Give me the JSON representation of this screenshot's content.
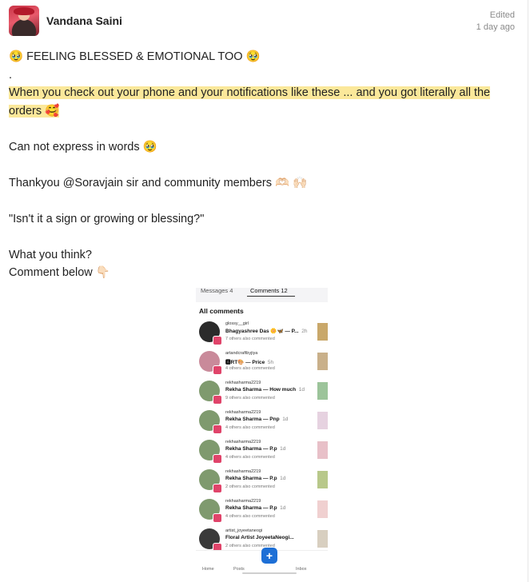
{
  "post": {
    "author": "Vandana Saini",
    "edited": "Edited",
    "time": "1 day ago",
    "lines": {
      "l1": "🥹 FEELING BLESSED & EMOTIONAL TOO 🥹",
      "l2": ".",
      "l3": "When you check out your phone and your notifications like these ... and you got literally all the",
      "l4": "orders 🥰",
      "l5": "Can not express in words 🥹",
      "l6": "Thankyou @Soravjain sir and community members 🫶🏻 🙌🏻",
      "l7": "\"Isn't it a sign or growing or blessing?\"",
      "l8": "What you think?",
      "l9": "Comment below 👇🏻"
    },
    "highlight_color": "#fbe89a"
  },
  "screenshot": {
    "tab_messages": "Messages  4",
    "tab_comments": "Comments  12",
    "all_comments": "All comments",
    "rows": [
      {
        "user": "glossy__girl",
        "msg": "Bhagyashree Das 🌼🦋 — P...",
        "meta": "2h",
        "others": "7 others also commented"
      },
      {
        "user": "artandcraftbyjiya",
        "msg": "🅰RT🎨 — Price",
        "meta": "5h",
        "others": "4 others also commented"
      },
      {
        "user": "rekhasharma2219",
        "msg": "Rekha Sharma — How much",
        "meta": "1d",
        "others": "9 others also commented"
      },
      {
        "user": "rekhasharma2219",
        "msg": "Rekha Sharma — Pnp",
        "meta": "1d",
        "others": "4 others also commented"
      },
      {
        "user": "rekhasharma2219",
        "msg": "Rekha Sharma — P.p",
        "meta": "1d",
        "others": "4 others also commented"
      },
      {
        "user": "rekhasharma2219",
        "msg": "Rekha Sharma — P.p",
        "meta": "1d",
        "others": "2 others also commented"
      },
      {
        "user": "rekhasharma2219",
        "msg": "Rekha Sharma — P.p",
        "meta": "1d",
        "others": "4 others also commented"
      },
      {
        "user": "artist_joyeetaneogi",
        "msg": "Floral Artist JoyeetaNeogi...",
        "meta": "",
        "others": "2 others also commented"
      }
    ],
    "nav": {
      "home": "Home",
      "posts": "Posts",
      "plus": "+",
      "inbox": "Inbox"
    }
  }
}
